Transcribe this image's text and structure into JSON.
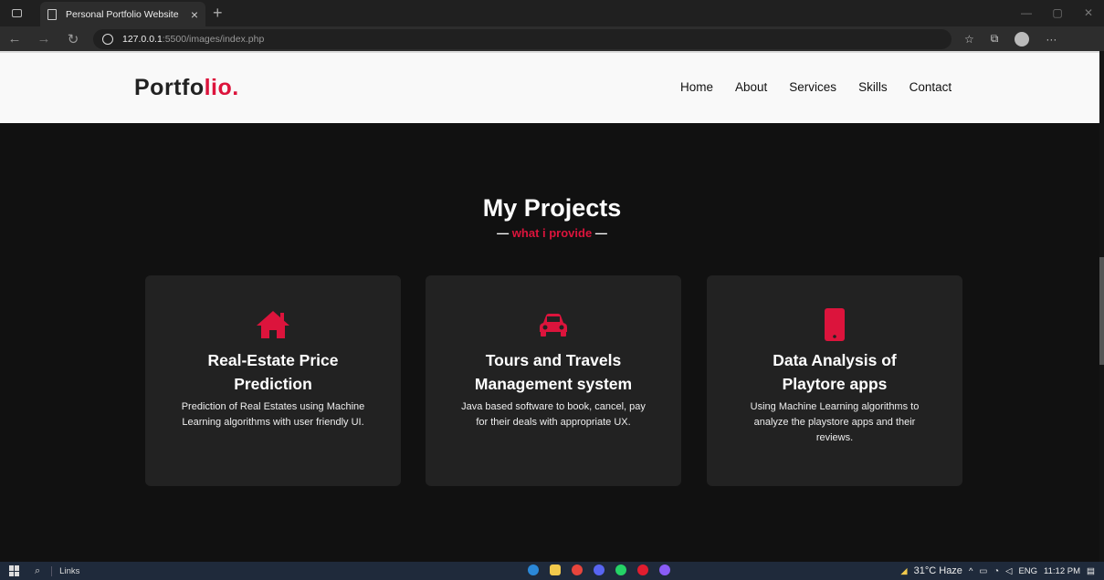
{
  "browser": {
    "tab_title": "Personal Portfolio Website",
    "tab_close": "×",
    "new_tab": "+",
    "url_host": "127.0.0.1",
    "url_path": ":5500/images/index.php"
  },
  "navbar": {
    "logo_main": "Portfo",
    "logo_accent": "lio.",
    "menu": [
      "Home",
      "About",
      "Services",
      "Skills",
      "Contact"
    ]
  },
  "section": {
    "title": "My Projects",
    "subtitle": "what i provide",
    "dash": "—"
  },
  "cards": [
    {
      "icon": "house-icon",
      "title": "Real-Estate Price Prediction",
      "desc": "Prediction of Real Estates using Machine Learning algorithms with user friendly UI."
    },
    {
      "icon": "car-icon",
      "title": "Tours and Travels Management system",
      "desc": "Java based software to book, cancel, pay for their deals with appropriate UX."
    },
    {
      "icon": "mobile-icon",
      "title": "Data Analysis of Playtore apps",
      "desc": "Using Machine Learning algorithms to analyze the playstore apps and their reviews."
    }
  ],
  "taskbar": {
    "links_label": "Links",
    "weather": "31°C Haze",
    "language": "ENG",
    "time": "11:12 PM"
  },
  "colors": {
    "accent": "#dc143c",
    "page_bg": "#111111",
    "card_bg": "#222222"
  }
}
